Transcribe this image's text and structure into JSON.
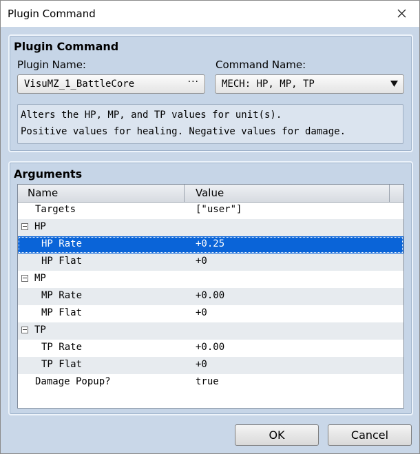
{
  "window": {
    "title": "Plugin Command"
  },
  "plugin_command": {
    "group_title": "Plugin Command",
    "plugin_name_label": "Plugin Name:",
    "plugin_name_value": "VisuMZ_1_BattleCore",
    "plugin_name_button": "···",
    "command_name_label": "Command Name:",
    "command_name_value": "MECH: HP, MP, TP",
    "description": [
      "Alters the HP, MP, and TP values for unit(s).",
      "Positive values for healing. Negative values for damage."
    ]
  },
  "arguments": {
    "group_title": "Arguments",
    "columns": [
      "Name",
      "Value"
    ],
    "rows": [
      {
        "name": "Targets",
        "value": "[\"user\"]",
        "level": 1,
        "group": false,
        "selected": false
      },
      {
        "name": "HP",
        "value": "",
        "level": 0,
        "group": true,
        "selected": false
      },
      {
        "name": "HP Rate",
        "value": "+0.25",
        "level": 2,
        "group": false,
        "selected": true
      },
      {
        "name": "HP Flat",
        "value": "+0",
        "level": 2,
        "group": false,
        "selected": false
      },
      {
        "name": "MP",
        "value": "",
        "level": 0,
        "group": true,
        "selected": false
      },
      {
        "name": "MP Rate",
        "value": "+0.00",
        "level": 2,
        "group": false,
        "selected": false
      },
      {
        "name": "MP Flat",
        "value": "+0",
        "level": 2,
        "group": false,
        "selected": false
      },
      {
        "name": "TP",
        "value": "",
        "level": 0,
        "group": true,
        "selected": false
      },
      {
        "name": "TP Rate",
        "value": "+0.00",
        "level": 2,
        "group": false,
        "selected": false
      },
      {
        "name": "TP Flat",
        "value": "+0",
        "level": 2,
        "group": false,
        "selected": false
      },
      {
        "name": "Damage Popup?",
        "value": "true",
        "level": 1,
        "group": false,
        "selected": false
      }
    ]
  },
  "buttons": {
    "ok": "OK",
    "cancel": "Cancel"
  },
  "colors": {
    "selection": "#0a64d8",
    "panel": "#c6d5e7"
  }
}
